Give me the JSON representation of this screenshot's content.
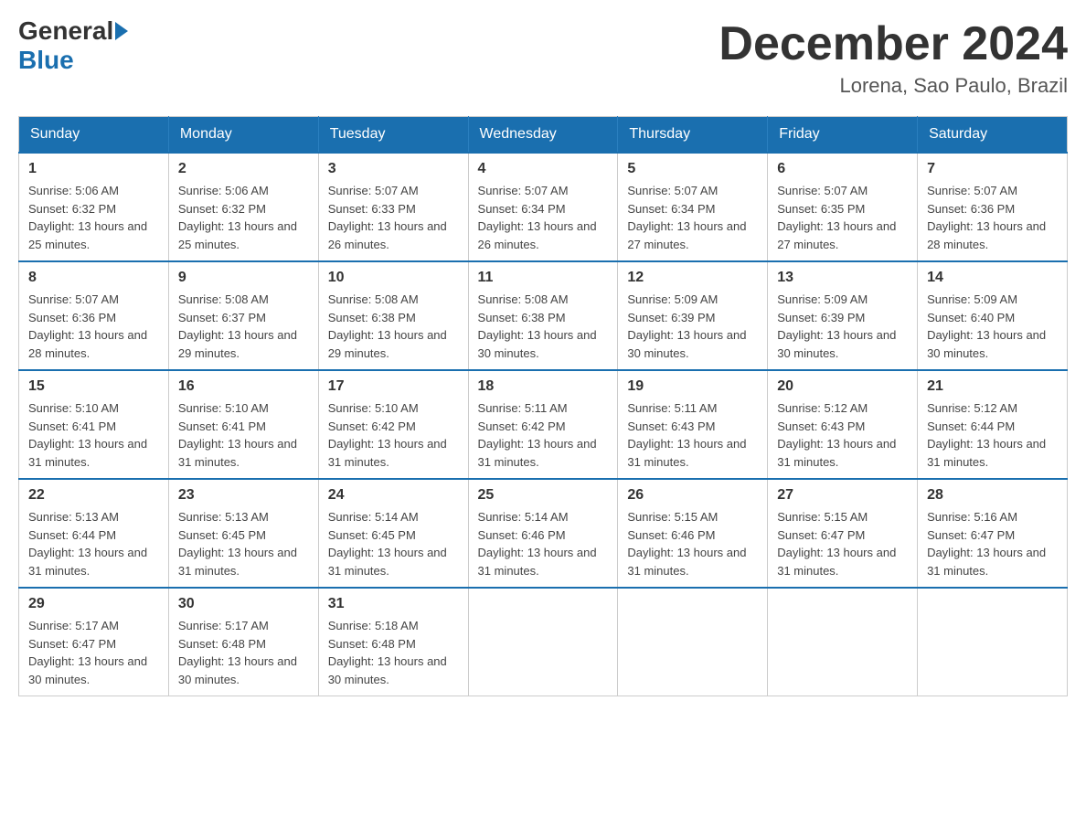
{
  "header": {
    "logo": {
      "text_general": "General",
      "text_blue": "Blue"
    },
    "title": "December 2024",
    "location": "Lorena, Sao Paulo, Brazil"
  },
  "calendar": {
    "days_of_week": [
      "Sunday",
      "Monday",
      "Tuesday",
      "Wednesday",
      "Thursday",
      "Friday",
      "Saturday"
    ],
    "weeks": [
      [
        {
          "day": "1",
          "sunrise": "Sunrise: 5:06 AM",
          "sunset": "Sunset: 6:32 PM",
          "daylight": "Daylight: 13 hours and 25 minutes."
        },
        {
          "day": "2",
          "sunrise": "Sunrise: 5:06 AM",
          "sunset": "Sunset: 6:32 PM",
          "daylight": "Daylight: 13 hours and 25 minutes."
        },
        {
          "day": "3",
          "sunrise": "Sunrise: 5:07 AM",
          "sunset": "Sunset: 6:33 PM",
          "daylight": "Daylight: 13 hours and 26 minutes."
        },
        {
          "day": "4",
          "sunrise": "Sunrise: 5:07 AM",
          "sunset": "Sunset: 6:34 PM",
          "daylight": "Daylight: 13 hours and 26 minutes."
        },
        {
          "day": "5",
          "sunrise": "Sunrise: 5:07 AM",
          "sunset": "Sunset: 6:34 PM",
          "daylight": "Daylight: 13 hours and 27 minutes."
        },
        {
          "day": "6",
          "sunrise": "Sunrise: 5:07 AM",
          "sunset": "Sunset: 6:35 PM",
          "daylight": "Daylight: 13 hours and 27 minutes."
        },
        {
          "day": "7",
          "sunrise": "Sunrise: 5:07 AM",
          "sunset": "Sunset: 6:36 PM",
          "daylight": "Daylight: 13 hours and 28 minutes."
        }
      ],
      [
        {
          "day": "8",
          "sunrise": "Sunrise: 5:07 AM",
          "sunset": "Sunset: 6:36 PM",
          "daylight": "Daylight: 13 hours and 28 minutes."
        },
        {
          "day": "9",
          "sunrise": "Sunrise: 5:08 AM",
          "sunset": "Sunset: 6:37 PM",
          "daylight": "Daylight: 13 hours and 29 minutes."
        },
        {
          "day": "10",
          "sunrise": "Sunrise: 5:08 AM",
          "sunset": "Sunset: 6:38 PM",
          "daylight": "Daylight: 13 hours and 29 minutes."
        },
        {
          "day": "11",
          "sunrise": "Sunrise: 5:08 AM",
          "sunset": "Sunset: 6:38 PM",
          "daylight": "Daylight: 13 hours and 30 minutes."
        },
        {
          "day": "12",
          "sunrise": "Sunrise: 5:09 AM",
          "sunset": "Sunset: 6:39 PM",
          "daylight": "Daylight: 13 hours and 30 minutes."
        },
        {
          "day": "13",
          "sunrise": "Sunrise: 5:09 AM",
          "sunset": "Sunset: 6:39 PM",
          "daylight": "Daylight: 13 hours and 30 minutes."
        },
        {
          "day": "14",
          "sunrise": "Sunrise: 5:09 AM",
          "sunset": "Sunset: 6:40 PM",
          "daylight": "Daylight: 13 hours and 30 minutes."
        }
      ],
      [
        {
          "day": "15",
          "sunrise": "Sunrise: 5:10 AM",
          "sunset": "Sunset: 6:41 PM",
          "daylight": "Daylight: 13 hours and 31 minutes."
        },
        {
          "day": "16",
          "sunrise": "Sunrise: 5:10 AM",
          "sunset": "Sunset: 6:41 PM",
          "daylight": "Daylight: 13 hours and 31 minutes."
        },
        {
          "day": "17",
          "sunrise": "Sunrise: 5:10 AM",
          "sunset": "Sunset: 6:42 PM",
          "daylight": "Daylight: 13 hours and 31 minutes."
        },
        {
          "day": "18",
          "sunrise": "Sunrise: 5:11 AM",
          "sunset": "Sunset: 6:42 PM",
          "daylight": "Daylight: 13 hours and 31 minutes."
        },
        {
          "day": "19",
          "sunrise": "Sunrise: 5:11 AM",
          "sunset": "Sunset: 6:43 PM",
          "daylight": "Daylight: 13 hours and 31 minutes."
        },
        {
          "day": "20",
          "sunrise": "Sunrise: 5:12 AM",
          "sunset": "Sunset: 6:43 PM",
          "daylight": "Daylight: 13 hours and 31 minutes."
        },
        {
          "day": "21",
          "sunrise": "Sunrise: 5:12 AM",
          "sunset": "Sunset: 6:44 PM",
          "daylight": "Daylight: 13 hours and 31 minutes."
        }
      ],
      [
        {
          "day": "22",
          "sunrise": "Sunrise: 5:13 AM",
          "sunset": "Sunset: 6:44 PM",
          "daylight": "Daylight: 13 hours and 31 minutes."
        },
        {
          "day": "23",
          "sunrise": "Sunrise: 5:13 AM",
          "sunset": "Sunset: 6:45 PM",
          "daylight": "Daylight: 13 hours and 31 minutes."
        },
        {
          "day": "24",
          "sunrise": "Sunrise: 5:14 AM",
          "sunset": "Sunset: 6:45 PM",
          "daylight": "Daylight: 13 hours and 31 minutes."
        },
        {
          "day": "25",
          "sunrise": "Sunrise: 5:14 AM",
          "sunset": "Sunset: 6:46 PM",
          "daylight": "Daylight: 13 hours and 31 minutes."
        },
        {
          "day": "26",
          "sunrise": "Sunrise: 5:15 AM",
          "sunset": "Sunset: 6:46 PM",
          "daylight": "Daylight: 13 hours and 31 minutes."
        },
        {
          "day": "27",
          "sunrise": "Sunrise: 5:15 AM",
          "sunset": "Sunset: 6:47 PM",
          "daylight": "Daylight: 13 hours and 31 minutes."
        },
        {
          "day": "28",
          "sunrise": "Sunrise: 5:16 AM",
          "sunset": "Sunset: 6:47 PM",
          "daylight": "Daylight: 13 hours and 31 minutes."
        }
      ],
      [
        {
          "day": "29",
          "sunrise": "Sunrise: 5:17 AM",
          "sunset": "Sunset: 6:47 PM",
          "daylight": "Daylight: 13 hours and 30 minutes."
        },
        {
          "day": "30",
          "sunrise": "Sunrise: 5:17 AM",
          "sunset": "Sunset: 6:48 PM",
          "daylight": "Daylight: 13 hours and 30 minutes."
        },
        {
          "day": "31",
          "sunrise": "Sunrise: 5:18 AM",
          "sunset": "Sunset: 6:48 PM",
          "daylight": "Daylight: 13 hours and 30 minutes."
        },
        null,
        null,
        null,
        null
      ]
    ]
  }
}
